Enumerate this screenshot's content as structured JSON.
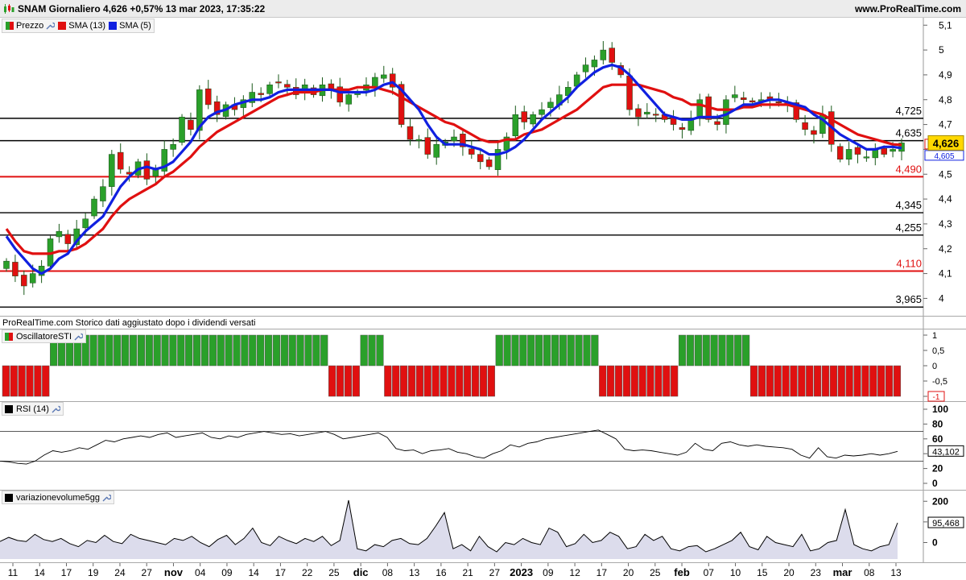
{
  "header": {
    "title": "SNAM Giornaliero 4,626 +0,57% 13 mar 2023, 17:35:22",
    "site": "www.ProRealTime.com"
  },
  "legend": {
    "items": [
      {
        "label": "Prezzo",
        "color": "#2e8b2e"
      },
      {
        "label": "SMA (13)",
        "color": "#e00000"
      },
      {
        "label": "SMA (5)",
        "color": "#0000e0"
      }
    ]
  },
  "note": "ProRealTime.com Storico dati aggiustato dopo i dividendi versati",
  "colors": {
    "up": "#2aa02a",
    "down": "#e01010",
    "sma13": "#e01010",
    "sma5": "#1020e0",
    "last_bg": "#ffd800",
    "indicator_fill": "#dcdcec"
  },
  "chart_data": [
    {
      "type": "candlestick",
      "title": "SNAM Giornaliero",
      "x_tick_labels": [
        "11",
        "14",
        "17",
        "19",
        "24",
        "27",
        "nov",
        "04",
        "09",
        "14",
        "17",
        "22",
        "25",
        "dic",
        "08",
        "13",
        "16",
        "21",
        "27",
        "2023",
        "09",
        "12",
        "17",
        "20",
        "25",
        "feb",
        "07",
        "10",
        "15",
        "20",
        "23",
        "mar",
        "08",
        "13"
      ],
      "y_tick_labels": [
        "5,1",
        "5",
        "4,9",
        "4,8",
        "4,7",
        "4,6",
        "4,5",
        "4,4",
        "4,3",
        "4,2",
        "4,1",
        "4"
      ],
      "ylim": [
        3.93,
        5.13
      ],
      "last_price": "4,626",
      "sma13_last": "4,618",
      "sma5_last": "4,605",
      "levels": [
        {
          "value": 4.725,
          "label": "4,725",
          "color": "#000000"
        },
        {
          "value": 4.635,
          "label": "4,635",
          "color": "#000000"
        },
        {
          "value": 4.49,
          "label": "4,490",
          "color": "#e01010"
        },
        {
          "value": 4.345,
          "label": "4,345",
          "color": "#000000"
        },
        {
          "value": 4.255,
          "label": "4,255",
          "color": "#000000"
        },
        {
          "value": 4.11,
          "label": "4,110",
          "color": "#e01010"
        },
        {
          "value": 3.965,
          "label": "3,965",
          "color": "#000000"
        }
      ],
      "close": [
        4.15,
        4.09,
        4.05,
        4.1,
        4.13,
        4.24,
        4.27,
        4.22,
        4.28,
        4.32,
        4.4,
        4.45,
        4.58,
        4.52,
        4.5,
        4.55,
        4.48,
        4.52,
        4.6,
        4.62,
        4.73,
        4.68,
        4.84,
        4.78,
        4.74,
        4.78,
        4.76,
        4.8,
        4.83,
        4.82,
        4.86,
        4.87,
        4.85,
        4.82,
        4.86,
        4.82,
        4.86,
        4.84,
        4.79,
        4.82,
        4.83,
        4.86,
        4.89,
        4.9,
        4.85,
        4.7,
        4.64,
        4.64,
        4.58,
        4.62,
        4.63,
        4.65,
        4.61,
        4.58,
        4.55,
        4.53,
        4.6,
        4.65,
        4.74,
        4.71,
        4.74,
        4.76,
        4.79,
        4.82,
        4.85,
        4.9,
        4.94,
        4.96,
        5.0,
        4.95,
        4.9,
        4.76,
        4.73,
        4.75,
        4.74,
        4.72,
        4.7,
        4.68,
        4.72,
        4.8,
        4.72,
        4.7,
        4.8,
        4.82,
        4.8,
        4.79,
        4.8,
        4.8,
        4.79,
        4.78,
        4.72,
        4.68,
        4.66,
        4.74,
        4.62,
        4.56,
        4.6,
        4.58,
        4.57,
        4.6,
        4.58,
        4.6,
        4.626
      ],
      "sma13": [
        4.28,
        4.23,
        4.19,
        4.18,
        4.18,
        4.18,
        4.19,
        4.19,
        4.2,
        4.22,
        4.25,
        4.28,
        4.33,
        4.37,
        4.4,
        4.42,
        4.44,
        4.46,
        4.49,
        4.51,
        4.54,
        4.57,
        4.61,
        4.64,
        4.67,
        4.69,
        4.71,
        4.73,
        4.75,
        4.77,
        4.79,
        4.81,
        4.82,
        4.83,
        4.83,
        4.83,
        4.84,
        4.84,
        4.84,
        4.84,
        4.85,
        4.85,
        4.85,
        4.84,
        4.83,
        4.81,
        4.79,
        4.77,
        4.75,
        4.73,
        4.71,
        4.7,
        4.68,
        4.66,
        4.64,
        4.63,
        4.63,
        4.64,
        4.64,
        4.66,
        4.67,
        4.68,
        4.7,
        4.72,
        4.74,
        4.76,
        4.79,
        4.82,
        4.85,
        4.86,
        4.86,
        4.86,
        4.86,
        4.85,
        4.84,
        4.83,
        4.81,
        4.8,
        4.78,
        4.78,
        4.77,
        4.76,
        4.76,
        4.76,
        4.77,
        4.77,
        4.78,
        4.78,
        4.78,
        4.78,
        4.77,
        4.76,
        4.75,
        4.74,
        4.72,
        4.7,
        4.68,
        4.66,
        4.65,
        4.64,
        4.63,
        4.62,
        4.618
      ],
      "sma5": [
        4.25,
        4.2,
        4.16,
        4.12,
        4.1,
        4.12,
        4.16,
        4.18,
        4.23,
        4.27,
        4.3,
        4.33,
        4.39,
        4.45,
        4.49,
        4.52,
        4.53,
        4.52,
        4.53,
        4.55,
        4.59,
        4.63,
        4.69,
        4.73,
        4.75,
        4.76,
        4.78,
        4.79,
        4.8,
        4.8,
        4.81,
        4.83,
        4.84,
        4.84,
        4.84,
        4.84,
        4.84,
        4.84,
        4.83,
        4.83,
        4.83,
        4.83,
        4.84,
        4.86,
        4.87,
        4.84,
        4.8,
        4.76,
        4.7,
        4.65,
        4.62,
        4.62,
        4.62,
        4.61,
        4.6,
        4.58,
        4.58,
        4.59,
        4.61,
        4.64,
        4.68,
        4.72,
        4.75,
        4.78,
        4.81,
        4.85,
        4.88,
        4.91,
        4.93,
        4.94,
        4.93,
        4.9,
        4.86,
        4.82,
        4.78,
        4.74,
        4.73,
        4.72,
        4.72,
        4.73,
        4.73,
        4.73,
        4.74,
        4.76,
        4.78,
        4.78,
        4.79,
        4.8,
        4.8,
        4.79,
        4.78,
        4.77,
        4.74,
        4.72,
        4.69,
        4.66,
        4.64,
        4.62,
        4.6,
        4.6,
        4.61,
        4.61,
        4.605
      ]
    },
    {
      "type": "bar",
      "title": "OscillatoreSTI",
      "y_tick_labels": [
        "1",
        "0,5",
        "0",
        "-0,5",
        "-1"
      ],
      "ylim": [
        -1,
        1
      ],
      "last_value": "-1",
      "values": [
        -1,
        -1,
        -1,
        -1,
        -1,
        -1,
        1,
        1,
        1,
        1,
        1,
        1,
        1,
        1,
        1,
        1,
        1,
        1,
        1,
        1,
        1,
        1,
        1,
        1,
        1,
        1,
        1,
        1,
        1,
        1,
        1,
        1,
        1,
        1,
        1,
        1,
        1,
        1,
        1,
        1,
        1,
        -1,
        -1,
        -1,
        -1,
        1,
        1,
        1,
        -1,
        -1,
        -1,
        -1,
        -1,
        -1,
        -1,
        -1,
        -1,
        -1,
        -1,
        -1,
        -1,
        -1,
        1,
        1,
        1,
        1,
        1,
        1,
        1,
        1,
        1,
        1,
        1,
        1,
        1,
        -1,
        -1,
        -1,
        -1,
        -1,
        -1,
        -1,
        -1,
        -1,
        -1,
        1,
        1,
        1,
        1,
        1,
        1,
        1,
        1,
        1,
        -1,
        -1,
        -1,
        -1,
        -1,
        -1,
        -1,
        -1,
        -1,
        -1,
        -1,
        -1,
        -1,
        -1,
        -1,
        -1,
        -1,
        -1,
        -1
      ]
    },
    {
      "type": "line",
      "title": "RSI (14)",
      "y_tick_labels": [
        "100",
        "80",
        "60",
        "40",
        "20",
        "0"
      ],
      "ylim": [
        0,
        100
      ],
      "levels": [
        70,
        30
      ],
      "last_value": "43,102",
      "values": [
        30,
        29,
        27,
        26,
        30,
        38,
        44,
        42,
        44,
        48,
        46,
        52,
        58,
        56,
        60,
        62,
        64,
        62,
        66,
        68,
        62,
        64,
        66,
        68,
        62,
        60,
        64,
        62,
        66,
        68,
        70,
        68,
        66,
        67,
        64,
        66,
        68,
        70,
        66,
        60,
        62,
        64,
        66,
        68,
        62,
        47,
        44,
        45,
        40,
        44,
        45,
        47,
        42,
        40,
        36,
        34,
        40,
        44,
        52,
        49,
        54,
        56,
        60,
        62,
        64,
        66,
        68,
        70,
        72,
        66,
        60,
        46,
        44,
        45,
        44,
        42,
        40,
        38,
        42,
        54,
        46,
        44,
        54,
        56,
        52,
        50,
        52,
        50,
        49,
        48,
        46,
        38,
        34,
        48,
        36,
        34,
        38,
        37,
        38,
        40,
        38,
        40,
        43.1
      ]
    },
    {
      "type": "area",
      "title": "variazionevolume5gg",
      "y_tick_labels": [
        "200",
        "100",
        "0"
      ],
      "ylim": [
        -80,
        240
      ],
      "last_value": "95,468",
      "values": [
        5,
        25,
        10,
        5,
        40,
        15,
        5,
        20,
        -5,
        -20,
        10,
        0,
        35,
        5,
        -5,
        40,
        20,
        10,
        0,
        -10,
        20,
        10,
        30,
        0,
        -20,
        15,
        35,
        -10,
        20,
        70,
        0,
        -15,
        30,
        10,
        -5,
        20,
        5,
        30,
        -15,
        10,
        205,
        -30,
        -40,
        -10,
        -20,
        10,
        20,
        -5,
        -10,
        20,
        80,
        145,
        -30,
        -10,
        -40,
        30,
        -20,
        -45,
        0,
        -10,
        20,
        0,
        -10,
        70,
        50,
        -20,
        -5,
        40,
        0,
        10,
        50,
        30,
        -30,
        -20,
        40,
        10,
        30,
        -30,
        -40,
        -20,
        -15,
        -45,
        -30,
        -10,
        10,
        50,
        -20,
        -35,
        30,
        0,
        -10,
        -20,
        40,
        -40,
        -30,
        0,
        10,
        160,
        -10,
        -30,
        -40,
        -20,
        -10,
        95.5
      ]
    }
  ]
}
